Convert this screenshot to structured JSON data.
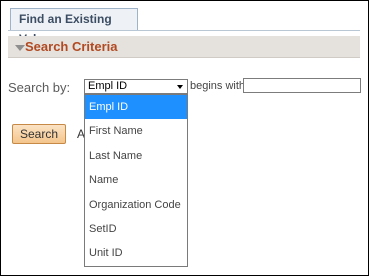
{
  "tab": {
    "label": "Find an Existing Value"
  },
  "criteria": {
    "label": "Search Criteria"
  },
  "search": {
    "label": "Search by:",
    "select_value": "Empl ID",
    "operator": "begins with",
    "input_value": ""
  },
  "buttons": {
    "search": "Search",
    "stray": "A"
  },
  "dropdown": {
    "options": [
      "Empl ID",
      "First Name",
      "Last Name",
      "Name",
      "Organization Code",
      "SetID",
      "Unit ID"
    ],
    "selected_index": 0,
    "highlight_color": "#1e90ff"
  }
}
